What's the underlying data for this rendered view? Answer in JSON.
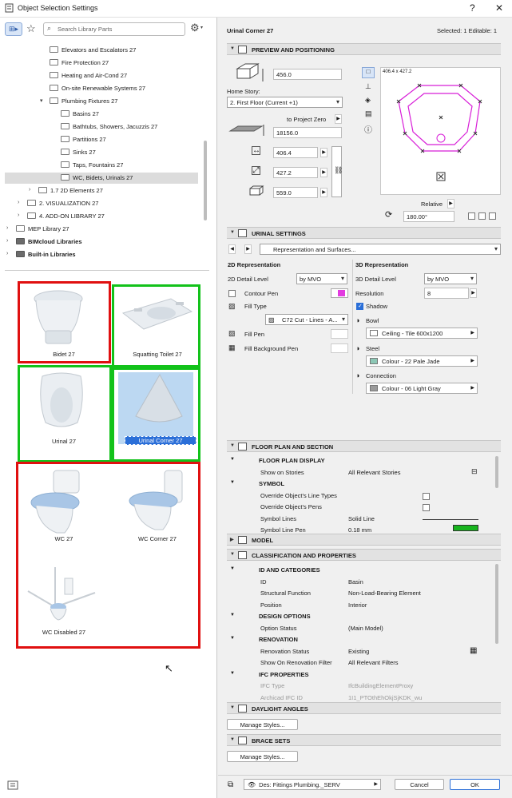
{
  "window": {
    "title": "Object Selection Settings",
    "controls": [
      "?",
      "✕"
    ]
  },
  "library": {
    "search_placeholder": "Search Library Parts",
    "tree": [
      {
        "label": "Elevators and Escalators 27",
        "indent": 3
      },
      {
        "label": "Fire Protection 27",
        "indent": 3
      },
      {
        "label": "Heating and Air-Cond 27",
        "indent": 3
      },
      {
        "label": "On-site Renewable Systems 27",
        "indent": 3
      },
      {
        "label": "Plumbing Fixtures 27",
        "indent": 3,
        "expanded": true
      },
      {
        "label": "Basins 27",
        "indent": 4
      },
      {
        "label": "Bathtubs, Showers, Jacuzzis 27",
        "indent": 4
      },
      {
        "label": "Partitions 27",
        "indent": 4
      },
      {
        "label": "Sinks 27",
        "indent": 4
      },
      {
        "label": "Taps, Fountains 27",
        "indent": 4
      },
      {
        "label": "WC, Bidets, Urinals 27",
        "indent": 4,
        "selected": true
      },
      {
        "label": "1.7 2D Elements 27",
        "indent": 2
      },
      {
        "label": "2. VISUALIZATION 27",
        "indent": 1
      },
      {
        "label": "4. ADD-ON LIBRARY 27",
        "indent": 1
      },
      {
        "label": "MEP Library 27",
        "indent": 0
      },
      {
        "label": "BIMcloud Libraries",
        "indent": 0,
        "bold": true
      },
      {
        "label": "Built-in Libraries",
        "indent": 0,
        "bold": true
      }
    ],
    "items": [
      "Bidet 27",
      "Squatting Toilet 27",
      "Urinal 27",
      "Urinal Corner 27",
      "WC 27",
      "WC Corner 27",
      "WC Disabled 27"
    ]
  },
  "header": {
    "title": "Urinal Corner 27",
    "selected": "Selected: 1 Editable: 1"
  },
  "preview": {
    "section": "PREVIEW AND POSITIONING",
    "height": "456.0",
    "home_story_label": "Home Story:",
    "home_story": "2. First Floor (Current +1)",
    "to_project_zero": "to Project Zero",
    "elevation": "18156.0",
    "dim_x": "406.4",
    "dim_y": "427.2",
    "dim_z": "559.0",
    "preview_size": "406.4 x 427.2",
    "relative": "Relative",
    "angle": "180.00°"
  },
  "urinal": {
    "section": "URINAL SETTINGS",
    "page": "Representation and Surfaces...",
    "rep2d": "2D Representation",
    "detail_2d_label": "2D Detail Level",
    "detail_2d": "by MVO",
    "contour_pen": "Contour Pen",
    "fill_type": "Fill Type",
    "fill_value": "C72 Cut - Lines - A...",
    "fill_pen": "Fill Pen",
    "fill_bg_pen": "Fill Background Pen",
    "rep3d": "3D Representation",
    "detail_3d_label": "3D Detail Level",
    "detail_3d": "by MVO",
    "resolution_label": "Resolution",
    "resolution": "8",
    "shadow": "Shadow",
    "bowl": "Bowl",
    "bowl_mat": "Ceiling - Tile 600x1200",
    "steel": "Steel",
    "steel_mat": "Colour - 22 Pale Jade",
    "connection": "Connection",
    "conn_mat": "Colour - 06 Light Gray",
    "colors": {
      "contour": "#e23be0",
      "steel": "#8cc7b5",
      "conn": "#9a9a9a",
      "bowl": "#ffffff"
    }
  },
  "floorplan": {
    "section": "FLOOR PLAN AND SECTION",
    "rows": [
      {
        "k": "FLOOR PLAN DISPLAY",
        "v": "",
        "grp": true
      },
      {
        "k": "Show on Stories",
        "v": "All Relevant Stories"
      },
      {
        "k": "SYMBOL",
        "v": "",
        "grp": true
      },
      {
        "k": "Override Object's Line Types",
        "v": ""
      },
      {
        "k": "Override Object's Pens",
        "v": ""
      },
      {
        "k": "Symbol Lines",
        "v": "Solid Line"
      },
      {
        "k": "Symbol Line Pen",
        "v": "0.18 mm"
      }
    ]
  },
  "model": {
    "section": "MODEL"
  },
  "classification": {
    "section": "CLASSIFICATION AND PROPERTIES",
    "rows": [
      {
        "k": "ID AND CATEGORIES",
        "v": "",
        "grp": true
      },
      {
        "k": "ID",
        "v": "Basin"
      },
      {
        "k": "Structural Function",
        "v": "Non-Load-Bearing Element"
      },
      {
        "k": "Position",
        "v": "Interior"
      },
      {
        "k": "DESIGN OPTIONS",
        "v": "",
        "grp": true
      },
      {
        "k": "Option Status",
        "v": "(Main Model)"
      },
      {
        "k": "RENOVATION",
        "v": "",
        "grp": true
      },
      {
        "k": "Renovation Status",
        "v": "Existing"
      },
      {
        "k": "Show On Renovation Filter",
        "v": "All Relevant Filters"
      },
      {
        "k": "IFC PROPERTIES",
        "v": "",
        "grp": true
      },
      {
        "k": "IFC Type",
        "v": "IfcBuildingElementProxy",
        "dim": true
      },
      {
        "k": "Archicad IFC ID",
        "v": "1I1_PTOthEhOkjSjKDK_wu",
        "dim": true
      }
    ]
  },
  "daylight": {
    "section": "DAYLIGHT ANGLES",
    "btn": "Manage Styles..."
  },
  "brace": {
    "section": "BRACE SETS",
    "btn": "Manage Styles..."
  },
  "footer": {
    "layer": "Des: Fittings Plumbing._SERV",
    "cancel": "Cancel",
    "ok": "OK"
  }
}
